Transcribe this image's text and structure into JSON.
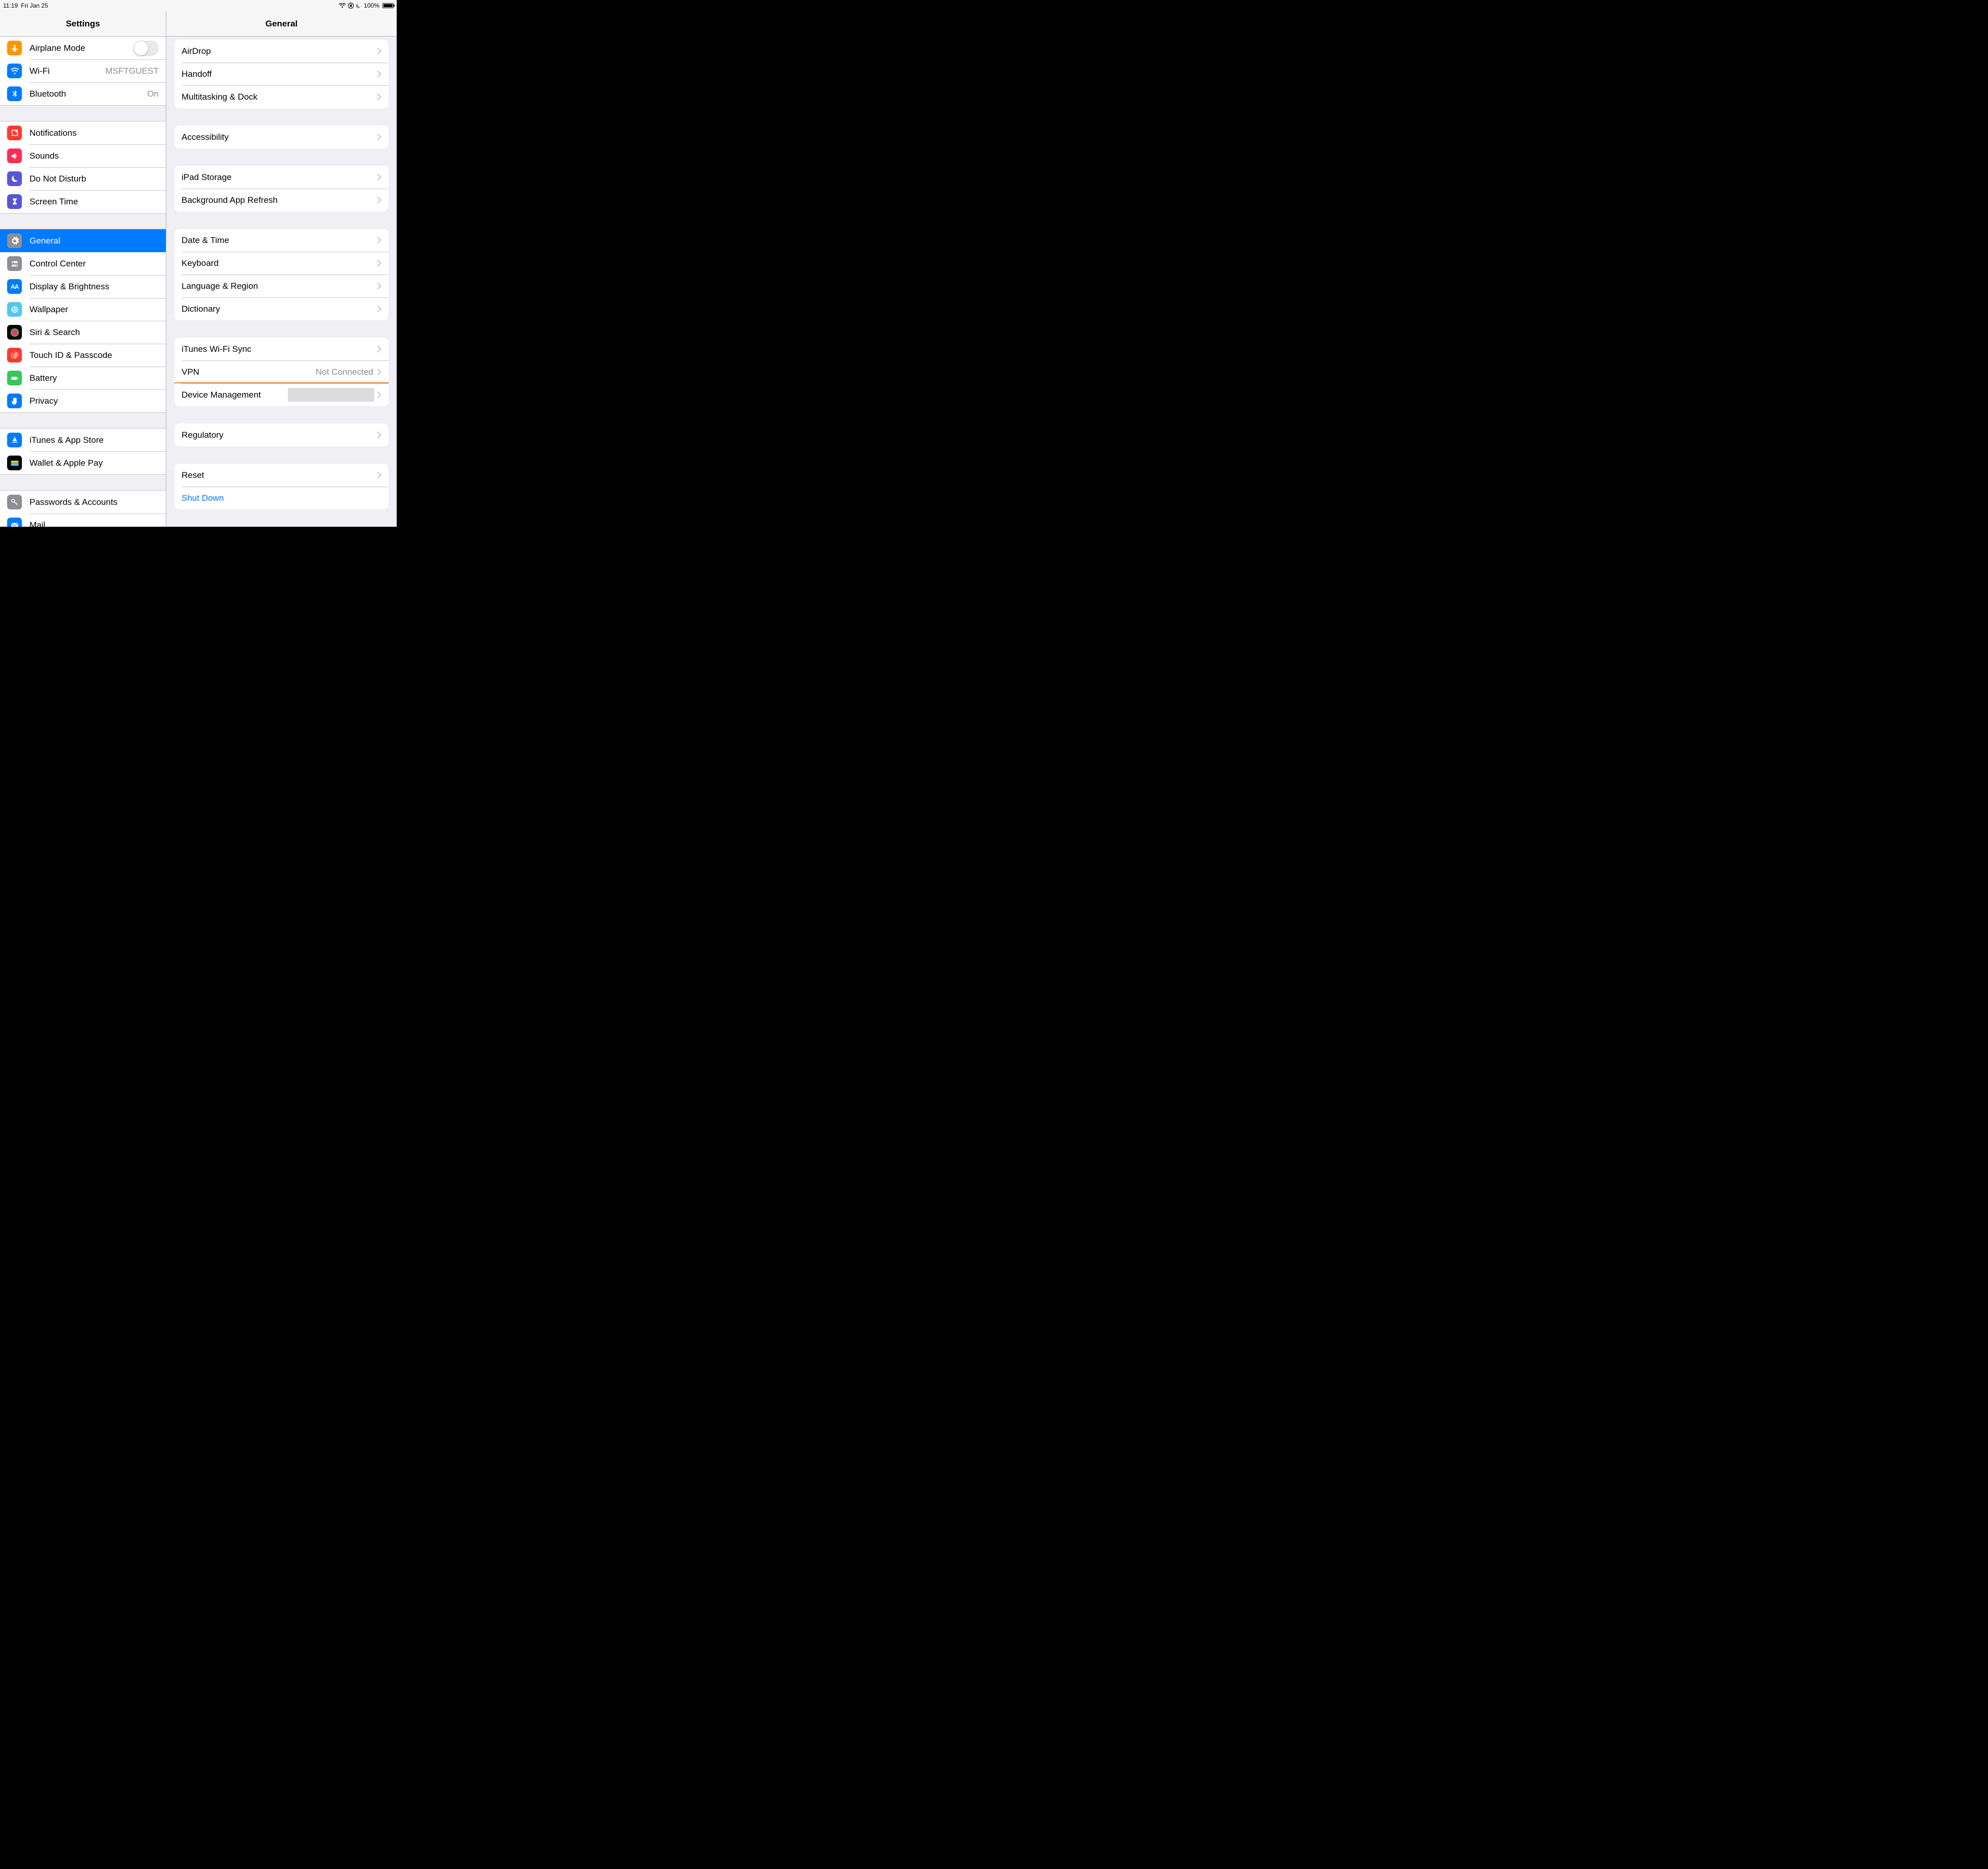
{
  "status": {
    "time": "11:19",
    "date": "Fri Jan 25",
    "battery_percent": "100%",
    "wifi_icon": "wifi",
    "orientation_lock_icon": "orientation-lock",
    "dnd_icon": "moon"
  },
  "header": {
    "left_title": "Settings",
    "right_title": "General"
  },
  "sidebar_groups": [
    {
      "items": [
        {
          "id": "airplane",
          "icon_bg": "#ff9500",
          "icon": "airplane",
          "label": "Airplane Mode",
          "toggle": false
        },
        {
          "id": "wifi",
          "icon_bg": "#007aff",
          "icon": "wifi",
          "label": "Wi-Fi",
          "detail": "MSFTGUEST"
        },
        {
          "id": "bluetooth",
          "icon_bg": "#007aff",
          "icon": "bluetooth",
          "label": "Bluetooth",
          "detail": "On"
        }
      ]
    },
    {
      "items": [
        {
          "id": "notifications",
          "icon_bg": "#ff3b30",
          "icon": "bell",
          "label": "Notifications"
        },
        {
          "id": "sounds",
          "icon_bg": "#ff2d55",
          "icon": "speaker",
          "label": "Sounds"
        },
        {
          "id": "dnd",
          "icon_bg": "#5856d6",
          "icon": "moon",
          "label": "Do Not Disturb"
        },
        {
          "id": "screentime",
          "icon_bg": "#5856d6",
          "icon": "hourglass",
          "label": "Screen Time"
        }
      ]
    },
    {
      "items": [
        {
          "id": "general",
          "icon_bg": "#8e8e93",
          "icon": "gear",
          "label": "General",
          "selected": true
        },
        {
          "id": "controlcenter",
          "icon_bg": "#8e8e93",
          "icon": "toggles",
          "label": "Control Center"
        },
        {
          "id": "display",
          "icon_bg": "#007aff",
          "icon": "aa",
          "label": "Display & Brightness"
        },
        {
          "id": "wallpaper",
          "icon_bg": "#54c7ec",
          "icon": "flower",
          "label": "Wallpaper"
        },
        {
          "id": "siri",
          "icon_bg": "#000000",
          "icon": "siri",
          "label": "Siri & Search"
        },
        {
          "id": "touchid",
          "icon_bg": "#ff3b30",
          "icon": "fingerprint",
          "label": "Touch ID & Passcode"
        },
        {
          "id": "battery",
          "icon_bg": "#34c759",
          "icon": "battery",
          "label": "Battery"
        },
        {
          "id": "privacy",
          "icon_bg": "#007aff",
          "icon": "hand",
          "label": "Privacy"
        }
      ]
    },
    {
      "items": [
        {
          "id": "appstore",
          "icon_bg": "#007aff",
          "icon": "appstore",
          "label": "iTunes & App Store"
        },
        {
          "id": "wallet",
          "icon_bg": "#000000",
          "icon": "wallet",
          "label": "Wallet & Apple Pay"
        }
      ]
    },
    {
      "items": [
        {
          "id": "passwords",
          "icon_bg": "#8e8e93",
          "icon": "key",
          "label": "Passwords & Accounts"
        },
        {
          "id": "mail",
          "icon_bg": "#007aff",
          "icon": "mail",
          "label": "Mail"
        }
      ]
    }
  ],
  "detail_groups": [
    {
      "rows": [
        {
          "id": "airdrop",
          "label": "AirDrop"
        },
        {
          "id": "handoff",
          "label": "Handoff"
        },
        {
          "id": "multitasking",
          "label": "Multitasking & Dock"
        }
      ]
    },
    {
      "rows": [
        {
          "id": "accessibility",
          "label": "Accessibility"
        }
      ]
    },
    {
      "rows": [
        {
          "id": "storage",
          "label": "iPad Storage"
        },
        {
          "id": "bgrefresh",
          "label": "Background App Refresh"
        }
      ]
    },
    {
      "rows": [
        {
          "id": "datetime",
          "label": "Date & Time"
        },
        {
          "id": "keyboard",
          "label": "Keyboard"
        },
        {
          "id": "language",
          "label": "Language & Region"
        },
        {
          "id": "dictionary",
          "label": "Dictionary"
        }
      ]
    },
    {
      "rows": [
        {
          "id": "itunessync",
          "label": "iTunes Wi-Fi Sync"
        },
        {
          "id": "vpn",
          "label": "VPN",
          "value": "Not Connected"
        },
        {
          "id": "devicemgmt",
          "label": "Device Management",
          "highlight": true,
          "redacted": true
        }
      ]
    },
    {
      "rows": [
        {
          "id": "regulatory",
          "label": "Regulatory"
        }
      ]
    },
    {
      "rows": [
        {
          "id": "reset",
          "label": "Reset"
        },
        {
          "id": "shutdown",
          "label": "Shut Down",
          "blue": true,
          "no_chevron": true
        }
      ]
    }
  ]
}
